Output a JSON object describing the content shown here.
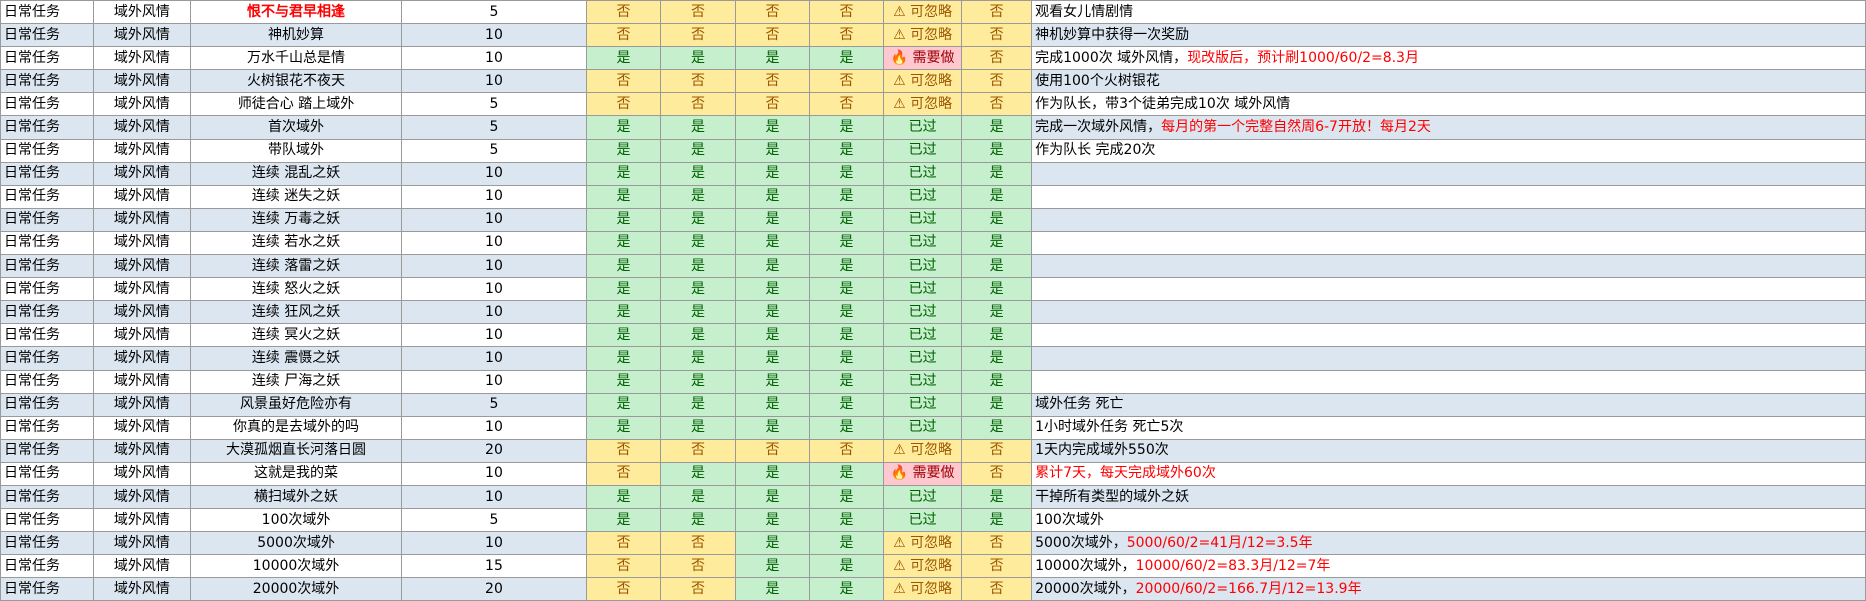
{
  "colors": {
    "yes_bg": "#c6efce",
    "no_bg": "#ffeb9c",
    "need_bg": "#ffc7ce",
    "alt_row": "#dce6f1",
    "red_text": "#ff0000"
  },
  "icons": {
    "ignore": "warning-icon",
    "need": "fire-icon"
  },
  "rows": [
    {
      "type": "日常任务",
      "cat": "域外风情",
      "name": "恨不与君早相逢",
      "name_red": true,
      "pts": "5",
      "f1": "否",
      "f2": "否",
      "f3": "否",
      "f4": "否",
      "status": "ignore",
      "status_label": "⚠ 可忽略",
      "f5": "否",
      "note": "观看女儿情剧情",
      "note_red": ""
    },
    {
      "type": "日常任务",
      "cat": "域外风情",
      "name": "神机妙算",
      "name_red": false,
      "pts": "10",
      "f1": "否",
      "f2": "否",
      "f3": "否",
      "f4": "否",
      "status": "ignore",
      "status_label": "⚠ 可忽略",
      "f5": "否",
      "note": "神机妙算中获得一次奖励",
      "note_red": ""
    },
    {
      "type": "日常任务",
      "cat": "域外风情",
      "name": "万水千山总是情",
      "name_red": false,
      "pts": "10",
      "f1": "是",
      "f2": "是",
      "f3": "是",
      "f4": "是",
      "status": "need",
      "status_label": "🔥 需要做",
      "f5": "否",
      "note": "完成1000次 域外风情，",
      "note_red": "现改版后，预计刷1000/60/2=8.3月"
    },
    {
      "type": "日常任务",
      "cat": "域外风情",
      "name": "火树银花不夜天",
      "name_red": false,
      "pts": "10",
      "f1": "否",
      "f2": "否",
      "f3": "否",
      "f4": "否",
      "status": "ignore",
      "status_label": "⚠ 可忽略",
      "f5": "否",
      "note": "使用100个火树银花",
      "note_red": ""
    },
    {
      "type": "日常任务",
      "cat": "域外风情",
      "name": "师徒合心 踏上域外",
      "name_red": false,
      "pts": "5",
      "f1": "否",
      "f2": "否",
      "f3": "否",
      "f4": "否",
      "status": "ignore",
      "status_label": "⚠ 可忽略",
      "f5": "否",
      "note": "作为队长，带3个徒弟完成10次 域外风情",
      "note_red": ""
    },
    {
      "type": "日常任务",
      "cat": "域外风情",
      "name": "首次域外",
      "name_red": false,
      "pts": "5",
      "f1": "是",
      "f2": "是",
      "f3": "是",
      "f4": "是",
      "status": "passed",
      "status_label": "已过",
      "f5": "是",
      "note": "完成一次域外风情，",
      "note_red": "每月的第一个完整自然周6-7开放！每月2天"
    },
    {
      "type": "日常任务",
      "cat": "域外风情",
      "name": "带队域外",
      "name_red": false,
      "pts": "5",
      "f1": "是",
      "f2": "是",
      "f3": "是",
      "f4": "是",
      "status": "passed",
      "status_label": "已过",
      "f5": "是",
      "note": "作为队长 完成20次",
      "note_red": ""
    },
    {
      "type": "日常任务",
      "cat": "域外风情",
      "name": "连续 混乱之妖",
      "name_red": false,
      "pts": "10",
      "f1": "是",
      "f2": "是",
      "f3": "是",
      "f4": "是",
      "status": "passed",
      "status_label": "已过",
      "f5": "是",
      "note": "",
      "note_red": ""
    },
    {
      "type": "日常任务",
      "cat": "域外风情",
      "name": "连续 迷失之妖",
      "name_red": false,
      "pts": "10",
      "f1": "是",
      "f2": "是",
      "f3": "是",
      "f4": "是",
      "status": "passed",
      "status_label": "已过",
      "f5": "是",
      "note": "",
      "note_red": ""
    },
    {
      "type": "日常任务",
      "cat": "域外风情",
      "name": "连续 万毒之妖",
      "name_red": false,
      "pts": "10",
      "f1": "是",
      "f2": "是",
      "f3": "是",
      "f4": "是",
      "status": "passed",
      "status_label": "已过",
      "f5": "是",
      "note": "",
      "note_red": ""
    },
    {
      "type": "日常任务",
      "cat": "域外风情",
      "name": "连续 若水之妖",
      "name_red": false,
      "pts": "10",
      "f1": "是",
      "f2": "是",
      "f3": "是",
      "f4": "是",
      "status": "passed",
      "status_label": "已过",
      "f5": "是",
      "note": "",
      "note_red": ""
    },
    {
      "type": "日常任务",
      "cat": "域外风情",
      "name": "连续 落雷之妖",
      "name_red": false,
      "pts": "10",
      "f1": "是",
      "f2": "是",
      "f3": "是",
      "f4": "是",
      "status": "passed",
      "status_label": "已过",
      "f5": "是",
      "note": "",
      "note_red": ""
    },
    {
      "type": "日常任务",
      "cat": "域外风情",
      "name": "连续 怒火之妖",
      "name_red": false,
      "pts": "10",
      "f1": "是",
      "f2": "是",
      "f3": "是",
      "f4": "是",
      "status": "passed",
      "status_label": "已过",
      "f5": "是",
      "note": "",
      "note_red": ""
    },
    {
      "type": "日常任务",
      "cat": "域外风情",
      "name": "连续 狂风之妖",
      "name_red": false,
      "pts": "10",
      "f1": "是",
      "f2": "是",
      "f3": "是",
      "f4": "是",
      "status": "passed",
      "status_label": "已过",
      "f5": "是",
      "note": "",
      "note_red": ""
    },
    {
      "type": "日常任务",
      "cat": "域外风情",
      "name": "连续 冥火之妖",
      "name_red": false,
      "pts": "10",
      "f1": "是",
      "f2": "是",
      "f3": "是",
      "f4": "是",
      "status": "passed",
      "status_label": "已过",
      "f5": "是",
      "note": "",
      "note_red": ""
    },
    {
      "type": "日常任务",
      "cat": "域外风情",
      "name": "连续 震慑之妖",
      "name_red": false,
      "pts": "10",
      "f1": "是",
      "f2": "是",
      "f3": "是",
      "f4": "是",
      "status": "passed",
      "status_label": "已过",
      "f5": "是",
      "note": "",
      "note_red": ""
    },
    {
      "type": "日常任务",
      "cat": "域外风情",
      "name": "连续 尸海之妖",
      "name_red": false,
      "pts": "10",
      "f1": "是",
      "f2": "是",
      "f3": "是",
      "f4": "是",
      "status": "passed",
      "status_label": "已过",
      "f5": "是",
      "note": "",
      "note_red": ""
    },
    {
      "type": "日常任务",
      "cat": "域外风情",
      "name": "风景虽好危险亦有",
      "name_red": false,
      "pts": "5",
      "f1": "是",
      "f2": "是",
      "f3": "是",
      "f4": "是",
      "status": "passed",
      "status_label": "已过",
      "f5": "是",
      "note": "域外任务 死亡",
      "note_red": ""
    },
    {
      "type": "日常任务",
      "cat": "域外风情",
      "name": "你真的是去域外的吗",
      "name_red": false,
      "pts": "10",
      "f1": "是",
      "f2": "是",
      "f3": "是",
      "f4": "是",
      "status": "passed",
      "status_label": "已过",
      "f5": "是",
      "note": "1小时域外任务 死亡5次",
      "note_red": ""
    },
    {
      "type": "日常任务",
      "cat": "域外风情",
      "name": "大漠孤烟直长河落日圆",
      "name_red": false,
      "pts": "20",
      "f1": "否",
      "f2": "否",
      "f3": "否",
      "f4": "否",
      "status": "ignore",
      "status_label": "⚠ 可忽略",
      "f5": "否",
      "note": "1天内完成域外550次",
      "note_red": ""
    },
    {
      "type": "日常任务",
      "cat": "域外风情",
      "name": "这就是我的菜",
      "name_red": false,
      "pts": "10",
      "f1": "否",
      "f2": "是",
      "f3": "是",
      "f4": "是",
      "status": "need",
      "status_label": "🔥 需要做",
      "f5": "否",
      "note": "",
      "note_red": "累计7天，每天完成域外60次"
    },
    {
      "type": "日常任务",
      "cat": "域外风情",
      "name": "横扫域外之妖",
      "name_red": false,
      "pts": "10",
      "f1": "是",
      "f2": "是",
      "f3": "是",
      "f4": "是",
      "status": "passed",
      "status_label": "已过",
      "f5": "是",
      "note": "干掉所有类型的域外之妖",
      "note_red": ""
    },
    {
      "type": "日常任务",
      "cat": "域外风情",
      "name": "100次域外",
      "name_red": false,
      "pts": "5",
      "f1": "是",
      "f2": "是",
      "f3": "是",
      "f4": "是",
      "status": "passed",
      "status_label": "已过",
      "f5": "是",
      "note": "100次域外",
      "note_red": ""
    },
    {
      "type": "日常任务",
      "cat": "域外风情",
      "name": "5000次域外",
      "name_red": false,
      "pts": "10",
      "f1": "否",
      "f2": "否",
      "f3": "是",
      "f4": "是",
      "status": "ignore",
      "status_label": "⚠ 可忽略",
      "f5": "否",
      "note": "5000次域外，",
      "note_red": "5000/60/2=41月/12=3.5年"
    },
    {
      "type": "日常任务",
      "cat": "域外风情",
      "name": "10000次域外",
      "name_red": false,
      "pts": "15",
      "f1": "否",
      "f2": "否",
      "f3": "是",
      "f4": "是",
      "status": "ignore",
      "status_label": "⚠ 可忽略",
      "f5": "否",
      "note": "10000次域外，",
      "note_red": "10000/60/2=83.3月/12=7年"
    },
    {
      "type": "日常任务",
      "cat": "域外风情",
      "name": "20000次域外",
      "name_red": false,
      "pts": "20",
      "f1": "否",
      "f2": "否",
      "f3": "是",
      "f4": "是",
      "status": "ignore",
      "status_label": "⚠ 可忽略",
      "f5": "否",
      "note": "20000次域外，",
      "note_red": "20000/60/2=166.7月/12=13.9年"
    }
  ]
}
